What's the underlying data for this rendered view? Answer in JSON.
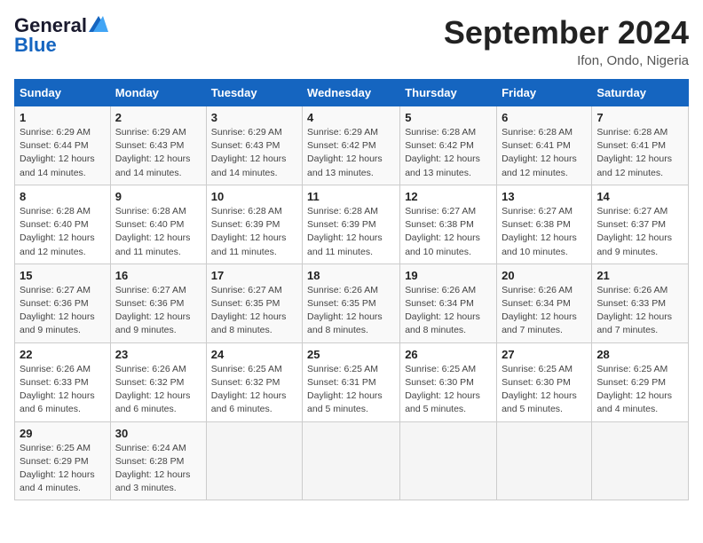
{
  "header": {
    "logo_line1": "General",
    "logo_line2": "Blue",
    "month": "September 2024",
    "location": "Ifon, Ondo, Nigeria"
  },
  "weekdays": [
    "Sunday",
    "Monday",
    "Tuesday",
    "Wednesday",
    "Thursday",
    "Friday",
    "Saturday"
  ],
  "weeks": [
    [
      {
        "day": "1",
        "sunrise": "6:29 AM",
        "sunset": "6:44 PM",
        "daylight": "12 hours and 14 minutes."
      },
      {
        "day": "2",
        "sunrise": "6:29 AM",
        "sunset": "6:43 PM",
        "daylight": "12 hours and 14 minutes."
      },
      {
        "day": "3",
        "sunrise": "6:29 AM",
        "sunset": "6:43 PM",
        "daylight": "12 hours and 14 minutes."
      },
      {
        "day": "4",
        "sunrise": "6:29 AM",
        "sunset": "6:42 PM",
        "daylight": "12 hours and 13 minutes."
      },
      {
        "day": "5",
        "sunrise": "6:28 AM",
        "sunset": "6:42 PM",
        "daylight": "12 hours and 13 minutes."
      },
      {
        "day": "6",
        "sunrise": "6:28 AM",
        "sunset": "6:41 PM",
        "daylight": "12 hours and 12 minutes."
      },
      {
        "day": "7",
        "sunrise": "6:28 AM",
        "sunset": "6:41 PM",
        "daylight": "12 hours and 12 minutes."
      }
    ],
    [
      {
        "day": "8",
        "sunrise": "6:28 AM",
        "sunset": "6:40 PM",
        "daylight": "12 hours and 12 minutes."
      },
      {
        "day": "9",
        "sunrise": "6:28 AM",
        "sunset": "6:40 PM",
        "daylight": "12 hours and 11 minutes."
      },
      {
        "day": "10",
        "sunrise": "6:28 AM",
        "sunset": "6:39 PM",
        "daylight": "12 hours and 11 minutes."
      },
      {
        "day": "11",
        "sunrise": "6:28 AM",
        "sunset": "6:39 PM",
        "daylight": "12 hours and 11 minutes."
      },
      {
        "day": "12",
        "sunrise": "6:27 AM",
        "sunset": "6:38 PM",
        "daylight": "12 hours and 10 minutes."
      },
      {
        "day": "13",
        "sunrise": "6:27 AM",
        "sunset": "6:38 PM",
        "daylight": "12 hours and 10 minutes."
      },
      {
        "day": "14",
        "sunrise": "6:27 AM",
        "sunset": "6:37 PM",
        "daylight": "12 hours and 9 minutes."
      }
    ],
    [
      {
        "day": "15",
        "sunrise": "6:27 AM",
        "sunset": "6:36 PM",
        "daylight": "12 hours and 9 minutes."
      },
      {
        "day": "16",
        "sunrise": "6:27 AM",
        "sunset": "6:36 PM",
        "daylight": "12 hours and 9 minutes."
      },
      {
        "day": "17",
        "sunrise": "6:27 AM",
        "sunset": "6:35 PM",
        "daylight": "12 hours and 8 minutes."
      },
      {
        "day": "18",
        "sunrise": "6:26 AM",
        "sunset": "6:35 PM",
        "daylight": "12 hours and 8 minutes."
      },
      {
        "day": "19",
        "sunrise": "6:26 AM",
        "sunset": "6:34 PM",
        "daylight": "12 hours and 8 minutes."
      },
      {
        "day": "20",
        "sunrise": "6:26 AM",
        "sunset": "6:34 PM",
        "daylight": "12 hours and 7 minutes."
      },
      {
        "day": "21",
        "sunrise": "6:26 AM",
        "sunset": "6:33 PM",
        "daylight": "12 hours and 7 minutes."
      }
    ],
    [
      {
        "day": "22",
        "sunrise": "6:26 AM",
        "sunset": "6:33 PM",
        "daylight": "12 hours and 6 minutes."
      },
      {
        "day": "23",
        "sunrise": "6:26 AM",
        "sunset": "6:32 PM",
        "daylight": "12 hours and 6 minutes."
      },
      {
        "day": "24",
        "sunrise": "6:25 AM",
        "sunset": "6:32 PM",
        "daylight": "12 hours and 6 minutes."
      },
      {
        "day": "25",
        "sunrise": "6:25 AM",
        "sunset": "6:31 PM",
        "daylight": "12 hours and 5 minutes."
      },
      {
        "day": "26",
        "sunrise": "6:25 AM",
        "sunset": "6:30 PM",
        "daylight": "12 hours and 5 minutes."
      },
      {
        "day": "27",
        "sunrise": "6:25 AM",
        "sunset": "6:30 PM",
        "daylight": "12 hours and 5 minutes."
      },
      {
        "day": "28",
        "sunrise": "6:25 AM",
        "sunset": "6:29 PM",
        "daylight": "12 hours and 4 minutes."
      }
    ],
    [
      {
        "day": "29",
        "sunrise": "6:25 AM",
        "sunset": "6:29 PM",
        "daylight": "12 hours and 4 minutes."
      },
      {
        "day": "30",
        "sunrise": "6:24 AM",
        "sunset": "6:28 PM",
        "daylight": "12 hours and 3 minutes."
      },
      null,
      null,
      null,
      null,
      null
    ]
  ]
}
